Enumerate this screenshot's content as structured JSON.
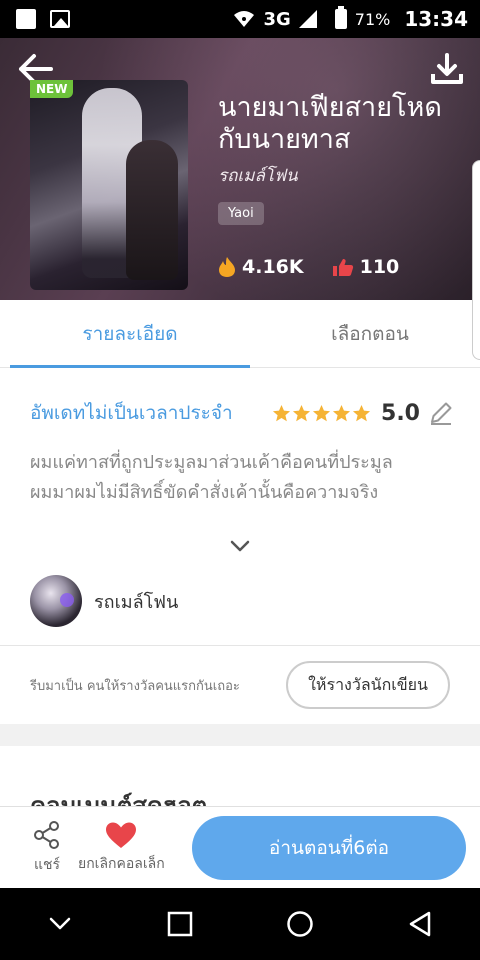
{
  "status_bar": {
    "network": "3G",
    "battery": "71%",
    "time": "13:34"
  },
  "hero": {
    "new_badge": "NEW",
    "title": "นายมาเฟียสายโหดกับนายทาส",
    "author": "รถเมล์โฟน",
    "tag": "Yaoi",
    "views": "4.16K",
    "likes": "110"
  },
  "tabs": {
    "details": "รายละเอียด",
    "chapters": "เลือกตอน"
  },
  "info": {
    "update_schedule": "อัพเดทไม่เป็นเวลาประจำ",
    "rating": "5.0",
    "stars": 5,
    "description_line1": "ผมแค่ทาสที่ถูกประมูลมาส่วนเค้าคือคนที่ประมูล",
    "description_line2": "ผมมาผมไม่มีสิทธิ์ขัดคำสั่งเค้านั้นคือความจริง"
  },
  "author": {
    "name": "รถเมล์โฟน"
  },
  "reward": {
    "text": "รีบมาเป็น คนให้รางวัลคนแรกกันเถอะ",
    "button": "ให้รางวัลนักเขียน"
  },
  "comments": {
    "title": "คอมเมนต์สุดฮอต"
  },
  "bottom_bar": {
    "share": "แชร์",
    "unfavorite": "ยกเลิกคอลเล็ก",
    "read_button": "อ่านตอนที่6ต่อ"
  },
  "colors": {
    "accent": "#4a9be0",
    "read_button": "#5fa8ec",
    "heart": "#e8454a",
    "star": "#f5b335",
    "new_badge": "#6dc23a"
  }
}
